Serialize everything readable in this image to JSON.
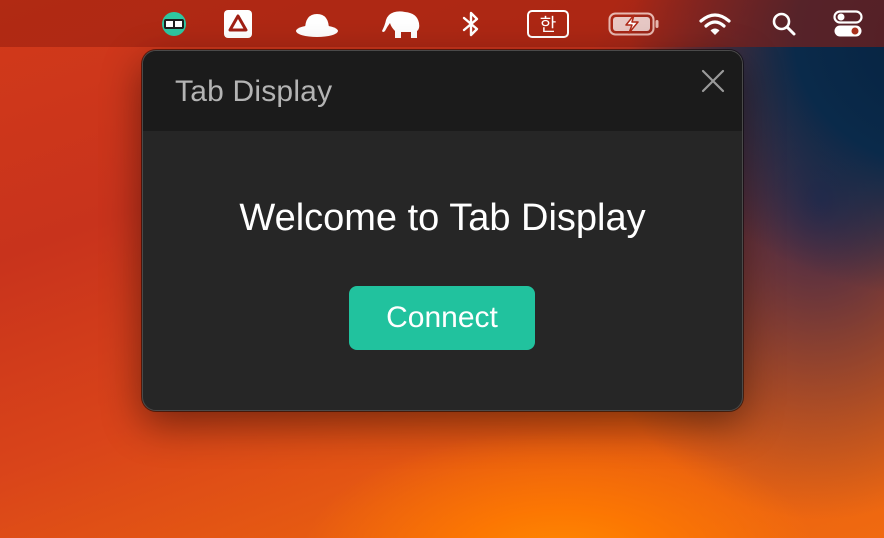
{
  "menubar": {
    "icons": [
      "tab-display-app-icon",
      "drive-icon",
      "hat-icon",
      "elephant-icon",
      "bluetooth-icon",
      "korean-input-icon",
      "battery-charging-icon",
      "wifi-icon",
      "search-icon",
      "control-center-icon"
    ],
    "input_source_label": "한"
  },
  "dialog": {
    "title": "Tab Display",
    "welcome_text": "Welcome to Tab Display",
    "connect_label": "Connect"
  },
  "colors": {
    "accent": "#21c29e",
    "panel_bg": "#262626",
    "header_bg": "#1b1b1b"
  }
}
